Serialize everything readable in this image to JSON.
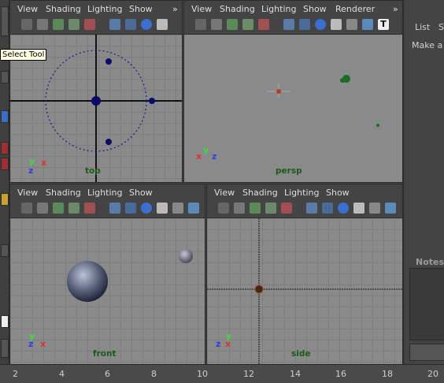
{
  "menus": {
    "top_left": [
      "View",
      "Shading",
      "Lighting",
      "Show"
    ],
    "top_right": [
      "View",
      "Shading",
      "Lighting",
      "Show",
      "Renderer"
    ],
    "bottom_left": [
      "View",
      "Shading",
      "Lighting",
      "Show"
    ],
    "bottom_right": [
      "View",
      "Shading",
      "Lighting",
      "Show"
    ]
  },
  "overflow_glyph": "»",
  "viewports": {
    "top": "top",
    "persp": "persp",
    "front": "front",
    "side": "side"
  },
  "axis": {
    "x": "x",
    "y": "y",
    "z": "z"
  },
  "tooltip": "Select Tool",
  "right_panel": {
    "tab_list": "List",
    "tab_se": "Se",
    "make_text": "Make a s",
    "notes_label": "Notes:"
  },
  "renderer_t_icon": "T",
  "ruler_ticks": [
    "2",
    "4",
    "6",
    "8",
    "10",
    "12",
    "14",
    "16",
    "18",
    "20"
  ],
  "colors": {
    "viewport_bg": "#8a8a8a",
    "ui_bg": "#444444",
    "accent_label": "#1b5a1b"
  }
}
